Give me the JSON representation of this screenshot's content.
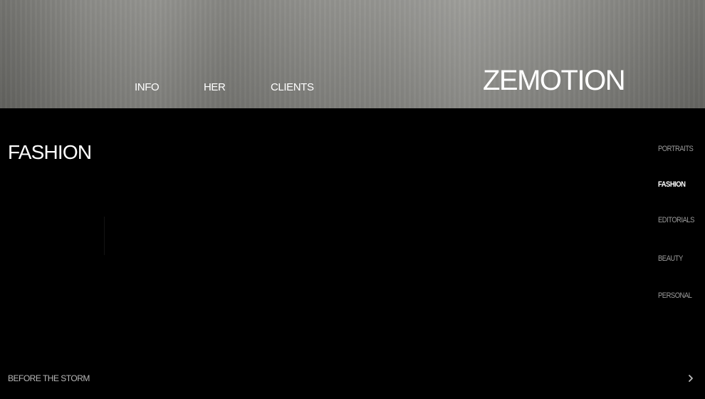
{
  "header": {
    "brand": "ZEMOTION",
    "nav": [
      {
        "label": "INFO"
      },
      {
        "label": "HER"
      },
      {
        "label": "CLIENTS"
      }
    ]
  },
  "main": {
    "title": "FASHION"
  },
  "side_menu": {
    "items": [
      {
        "label": "PORTRAITS",
        "active": false
      },
      {
        "label": "FASHION",
        "active": true
      },
      {
        "label": "EDITORIALS",
        "active": false
      },
      {
        "label": "BEAUTY",
        "active": false
      },
      {
        "label": "PERSONAL",
        "active": false
      }
    ]
  },
  "footer": {
    "caption": "BEFORE THE STORM",
    "next_icon": "chevron-right-icon"
  },
  "colors": {
    "background": "#000000",
    "text": "#ffffff",
    "muted_text": "#9a9a9a"
  }
}
